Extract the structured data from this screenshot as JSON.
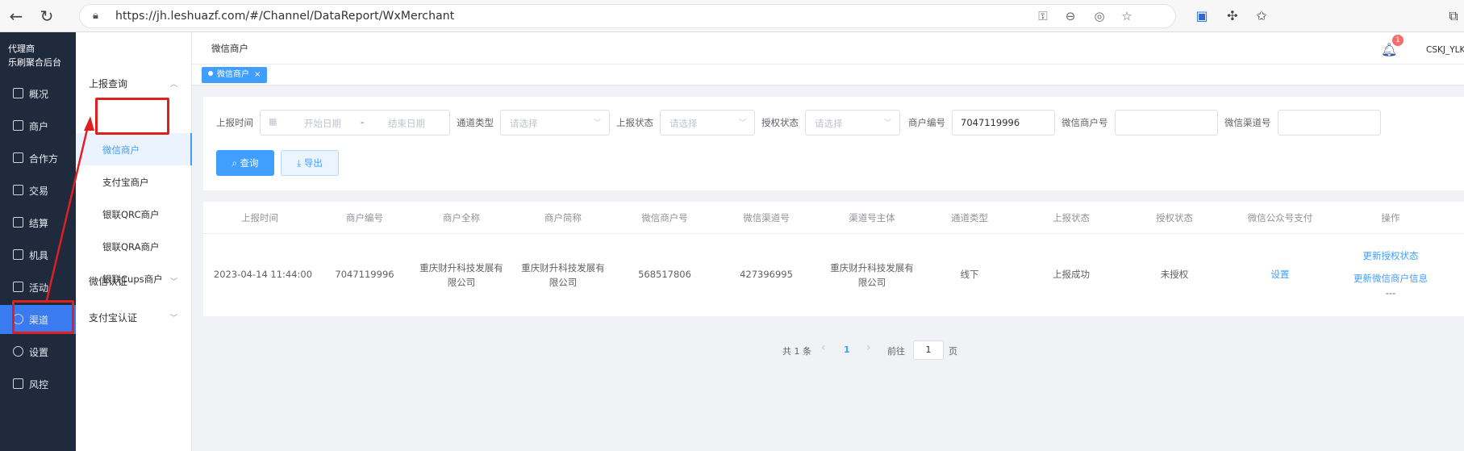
{
  "browser": {
    "url": "https://jh.leshuazf.com/#/Channel/DataReport/WxMerchant"
  },
  "brand": {
    "line1": "代理商",
    "line2": "乐刷聚合后台"
  },
  "main_nav": [
    {
      "label": "概况",
      "icon": "dashboard-icon"
    },
    {
      "label": "商户",
      "icon": "store-icon"
    },
    {
      "label": "合作方",
      "icon": "partner-icon"
    },
    {
      "label": "交易",
      "icon": "trade-icon"
    },
    {
      "label": "结算",
      "icon": "settle-icon"
    },
    {
      "label": "机具",
      "icon": "device-icon"
    },
    {
      "label": "活动",
      "icon": "activity-icon"
    },
    {
      "label": "渠道",
      "icon": "channel-icon"
    },
    {
      "label": "设置",
      "icon": "settings-icon"
    },
    {
      "label": "风控",
      "icon": "shield-icon"
    }
  ],
  "sub_nav": {
    "group1": "上报查询",
    "items": [
      "微信商户",
      "支付宝商户",
      "银联QRC商户",
      "银联QRA商户",
      "银联Cups商户"
    ],
    "group2": "微信认证",
    "group3": "支付宝认证"
  },
  "header": {
    "breadcrumb": "微信商户",
    "badge": "1",
    "user": "CSKJ_YLK"
  },
  "tags": {
    "active_tag": "微信商户",
    "close": "×"
  },
  "filters": {
    "report_time": "上报时间",
    "start_ph": "开始日期",
    "range_sep": "-",
    "end_ph": "结束日期",
    "channel_type": "通道类型",
    "channel_type_ph": "请选择",
    "report_status": "上报状态",
    "report_status_ph": "请选择",
    "auth_status": "授权状态",
    "auth_status_ph": "请选择",
    "merchant_no": "商户编号",
    "merchant_no_value": "7047119996",
    "wx_merchant_no": "微信商户号",
    "wx_channel_no": "微信渠道号",
    "query_btn": "查询",
    "export_btn": "导出"
  },
  "table": {
    "columns": [
      "上报时间",
      "商户编号",
      "商户全称",
      "商户简称",
      "微信商户号",
      "微信渠道号",
      "渠道号主体",
      "通道类型",
      "上报状态",
      "授权状态",
      "微信公众号支付",
      "操作"
    ],
    "row": {
      "time": "2023-04-14 11:44:00",
      "merchant_no": "7047119996",
      "full_name_l1": "重庆财升科技发展有",
      "full_name_l2": "限公司",
      "short_name_l1": "重庆财升科技发展有",
      "short_name_l2": "限公司",
      "wx_merchant_no": "568517806",
      "wx_channel_no": "427396995",
      "subject_l1": "重庆财升科技发展有",
      "subject_l2": "限公司",
      "channel_type": "线下",
      "report_status": "上报成功",
      "auth_status": "未授权",
      "wx_pay": "设置",
      "op1": "更新授权状态",
      "op2": "更新微信商户信息",
      "op3": "---"
    }
  },
  "pager": {
    "total": "共 1 条",
    "prev": "‹",
    "page": "1",
    "next": "›",
    "goto": "前往",
    "goto_value": "1",
    "page_unit": "页"
  }
}
